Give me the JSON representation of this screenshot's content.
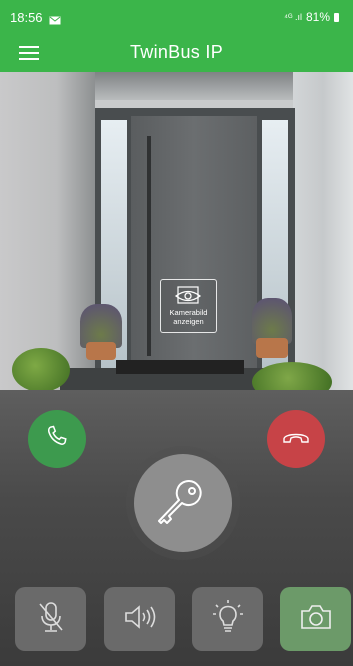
{
  "status_bar": {
    "time": "18:56",
    "signal_text": "⁴ᴳ .ıl",
    "battery": "81%"
  },
  "app_bar": {
    "title": "TwinBus IP"
  },
  "camera": {
    "overlay_label": "Kamerabild anzeigen"
  },
  "controls": {
    "accept_call": {
      "icon": "phone-icon",
      "color": "#3d9a4e"
    },
    "hang_up": {
      "icon": "phone-hangup-icon",
      "color": "#c74347"
    },
    "door_opener": {
      "icon": "key-icon"
    },
    "toolbar": [
      {
        "icon": "mic-muted-icon"
      },
      {
        "icon": "speaker-icon"
      },
      {
        "icon": "light-bulb-icon"
      },
      {
        "icon": "camera-icon",
        "color": "#6c9a69"
      }
    ]
  },
  "colors": {
    "brand_green": "#3bb54a"
  }
}
